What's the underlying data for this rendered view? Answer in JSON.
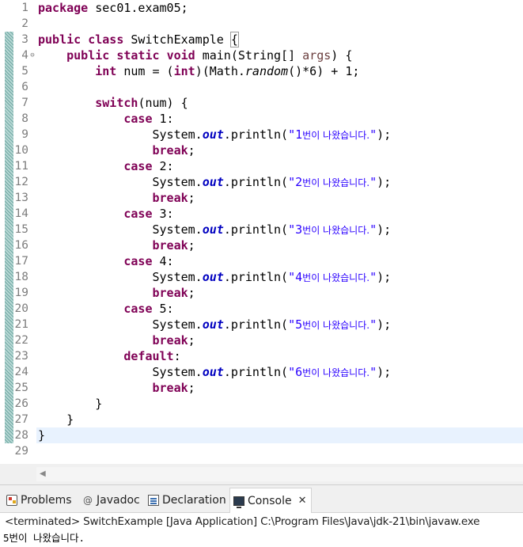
{
  "editor": {
    "lines": [
      {
        "no": "1",
        "tokens": [
          {
            "t": "package",
            "c": "kw"
          },
          {
            "t": " sec01.exam05;"
          }
        ]
      },
      {
        "no": "2",
        "tokens": []
      },
      {
        "no": "3",
        "tokens": [
          {
            "t": "public",
            "c": "kw"
          },
          {
            "t": " "
          },
          {
            "t": "class",
            "c": "kw"
          },
          {
            "t": " SwitchExample "
          },
          {
            "t": "{",
            "c": "brace-match"
          }
        ]
      },
      {
        "no": "4",
        "fold": "⊖",
        "tokens": [
          {
            "t": "    "
          },
          {
            "t": "public",
            "c": "kw"
          },
          {
            "t": " "
          },
          {
            "t": "static",
            "c": "kw"
          },
          {
            "t": " "
          },
          {
            "t": "void",
            "c": "kw"
          },
          {
            "t": " main(String[] "
          },
          {
            "t": "args",
            "c": "param"
          },
          {
            "t": ") {"
          }
        ]
      },
      {
        "no": "5",
        "tokens": [
          {
            "t": "        "
          },
          {
            "t": "int",
            "c": "kw"
          },
          {
            "t": " num = ("
          },
          {
            "t": "int",
            "c": "kw"
          },
          {
            "t": ")(Math."
          },
          {
            "t": "random",
            "c": "static-call"
          },
          {
            "t": "()*6) + 1;"
          }
        ]
      },
      {
        "no": "6",
        "tokens": []
      },
      {
        "no": "7",
        "tokens": [
          {
            "t": "        "
          },
          {
            "t": "switch",
            "c": "kw"
          },
          {
            "t": "(num) {"
          }
        ]
      },
      {
        "no": "8",
        "tokens": [
          {
            "t": "            "
          },
          {
            "t": "case",
            "c": "kw"
          },
          {
            "t": " 1:"
          }
        ]
      },
      {
        "no": "9",
        "tokens": [
          {
            "t": "                System."
          },
          {
            "t": "out",
            "c": "field"
          },
          {
            "t": ".println("
          },
          {
            "t": "\"1",
            "c": "str"
          },
          {
            "t": "번이 나왔습니다.",
            "c": "str str-ko"
          },
          {
            "t": "\"",
            "c": "str"
          },
          {
            "t": ");"
          }
        ]
      },
      {
        "no": "10",
        "tokens": [
          {
            "t": "                "
          },
          {
            "t": "break",
            "c": "kw"
          },
          {
            "t": ";"
          }
        ]
      },
      {
        "no": "11",
        "tokens": [
          {
            "t": "            "
          },
          {
            "t": "case",
            "c": "kw"
          },
          {
            "t": " 2:"
          }
        ]
      },
      {
        "no": "12",
        "tokens": [
          {
            "t": "                System."
          },
          {
            "t": "out",
            "c": "field"
          },
          {
            "t": ".println("
          },
          {
            "t": "\"2",
            "c": "str"
          },
          {
            "t": "번이 나왔습니다.",
            "c": "str str-ko"
          },
          {
            "t": "\"",
            "c": "str"
          },
          {
            "t": ");"
          }
        ]
      },
      {
        "no": "13",
        "tokens": [
          {
            "t": "                "
          },
          {
            "t": "break",
            "c": "kw"
          },
          {
            "t": ";"
          }
        ]
      },
      {
        "no": "14",
        "tokens": [
          {
            "t": "            "
          },
          {
            "t": "case",
            "c": "kw"
          },
          {
            "t": " 3:"
          }
        ]
      },
      {
        "no": "15",
        "tokens": [
          {
            "t": "                System."
          },
          {
            "t": "out",
            "c": "field"
          },
          {
            "t": ".println("
          },
          {
            "t": "\"3",
            "c": "str"
          },
          {
            "t": "번이 나왔습니다.",
            "c": "str str-ko"
          },
          {
            "t": "\"",
            "c": "str"
          },
          {
            "t": ");"
          }
        ]
      },
      {
        "no": "16",
        "tokens": [
          {
            "t": "                "
          },
          {
            "t": "break",
            "c": "kw"
          },
          {
            "t": ";"
          }
        ]
      },
      {
        "no": "17",
        "tokens": [
          {
            "t": "            "
          },
          {
            "t": "case",
            "c": "kw"
          },
          {
            "t": " 4:"
          }
        ]
      },
      {
        "no": "18",
        "tokens": [
          {
            "t": "                System."
          },
          {
            "t": "out",
            "c": "field"
          },
          {
            "t": ".println("
          },
          {
            "t": "\"4",
            "c": "str"
          },
          {
            "t": "번이 나왔습니다.",
            "c": "str str-ko"
          },
          {
            "t": "\"",
            "c": "str"
          },
          {
            "t": ");"
          }
        ]
      },
      {
        "no": "19",
        "tokens": [
          {
            "t": "                "
          },
          {
            "t": "break",
            "c": "kw"
          },
          {
            "t": ";"
          }
        ]
      },
      {
        "no": "20",
        "tokens": [
          {
            "t": "            "
          },
          {
            "t": "case",
            "c": "kw"
          },
          {
            "t": " 5:"
          }
        ]
      },
      {
        "no": "21",
        "tokens": [
          {
            "t": "                System."
          },
          {
            "t": "out",
            "c": "field"
          },
          {
            "t": ".println("
          },
          {
            "t": "\"5",
            "c": "str"
          },
          {
            "t": "번이 나왔습니다.",
            "c": "str str-ko"
          },
          {
            "t": "\"",
            "c": "str"
          },
          {
            "t": ");"
          }
        ]
      },
      {
        "no": "22",
        "tokens": [
          {
            "t": "                "
          },
          {
            "t": "break",
            "c": "kw"
          },
          {
            "t": ";"
          }
        ]
      },
      {
        "no": "23",
        "tokens": [
          {
            "t": "            "
          },
          {
            "t": "default",
            "c": "kw"
          },
          {
            "t": ":"
          }
        ]
      },
      {
        "no": "24",
        "tokens": [
          {
            "t": "                System."
          },
          {
            "t": "out",
            "c": "field"
          },
          {
            "t": ".println("
          },
          {
            "t": "\"6",
            "c": "str"
          },
          {
            "t": "번이 나왔습니다.",
            "c": "str str-ko"
          },
          {
            "t": "\"",
            "c": "str"
          },
          {
            "t": ");"
          }
        ]
      },
      {
        "no": "25",
        "tokens": [
          {
            "t": "                "
          },
          {
            "t": "break",
            "c": "kw"
          },
          {
            "t": ";"
          }
        ]
      },
      {
        "no": "26",
        "tokens": [
          {
            "t": "        }"
          }
        ]
      },
      {
        "no": "27",
        "tokens": [
          {
            "t": "    }"
          }
        ]
      },
      {
        "no": "28",
        "current": true,
        "tokens": [
          {
            "t": "}"
          }
        ]
      },
      {
        "no": "29",
        "tokens": []
      }
    ],
    "changed_lines": {
      "from": 3,
      "to": 28
    }
  },
  "scrollbar": {
    "left_arrow": "◀"
  },
  "bottom_panel": {
    "tabs": [
      {
        "id": "problems",
        "label": "Problems",
        "icon": "problems-icon",
        "active": false
      },
      {
        "id": "javadoc",
        "label": "Javadoc",
        "icon": "javadoc-icon",
        "glyph": "@",
        "active": false
      },
      {
        "id": "declaration",
        "label": "Declaration",
        "icon": "declaration-icon",
        "active": false
      },
      {
        "id": "console",
        "label": "Console",
        "icon": "console-icon",
        "active": true,
        "close": "✕"
      }
    ],
    "console_status": "<terminated> SwitchExample [Java Application] C:\\Program Files\\Java\\jdk-21\\bin\\javaw.exe",
    "console_output": "5번이 나왔습니다."
  },
  "colors": {
    "keyword": "#7f0055",
    "string": "#2a00ff",
    "field": "#0000c0",
    "current_line": "#e8f2fe",
    "change_bar": "#6fa9a3"
  }
}
